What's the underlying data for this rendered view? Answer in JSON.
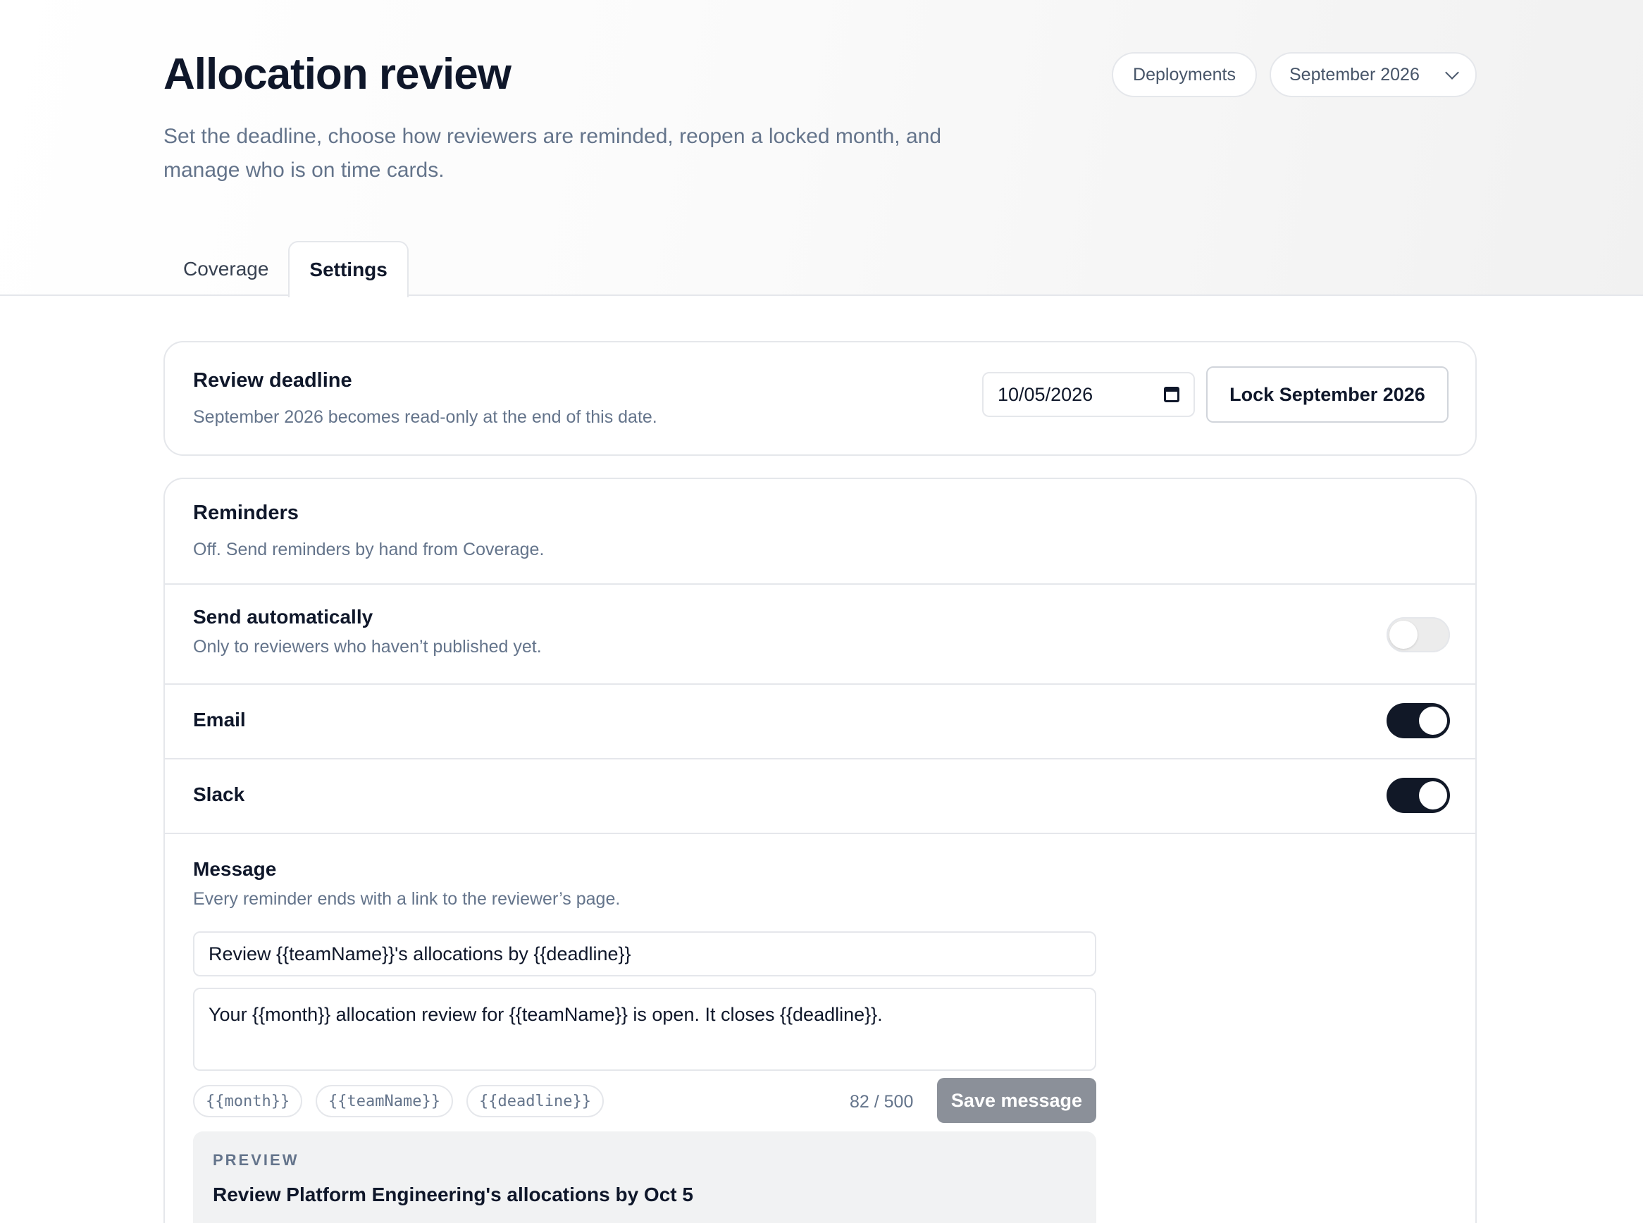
{
  "header": {
    "title": "Allocation review",
    "subtitle": "Set the deadline, choose how reviewers are reminded, reopen a locked month, and manage who is on time cards.",
    "deployments_label": "Deployments",
    "month_selector": "September 2026"
  },
  "tabs": [
    {
      "label": "Coverage",
      "active": false
    },
    {
      "label": "Settings",
      "active": true
    }
  ],
  "deadline": {
    "title": "Review deadline",
    "description": "September 2026 becomes read-only at the end of this date.",
    "date_value": "10/05/2026",
    "lock_button": "Lock September 2026"
  },
  "reminders": {
    "title": "Reminders",
    "status": "Off. Send reminders by hand from Coverage.",
    "send_auto": {
      "label": "Send automatically",
      "description": "Only to reviewers who haven’t published yet.",
      "enabled": false
    },
    "email": {
      "label": "Email",
      "enabled": true
    },
    "slack": {
      "label": "Slack",
      "enabled": true
    },
    "message": {
      "label": "Message",
      "description": "Every reminder ends with a link to the reviewer’s page.",
      "subject": "Review {{teamName}}'s allocations by {{deadline}}",
      "body": "Your {{month}} allocation review for {{teamName}} is open. It closes {{deadline}}.",
      "variables": [
        "{{month}}",
        "{{teamName}}",
        "{{deadline}}"
      ],
      "counter": "82 / 500",
      "save_button": "Save message"
    },
    "preview": {
      "label": "PREVIEW",
      "subject": "Review Platform Engineering's allocations by Oct 5"
    }
  },
  "colors": {
    "toggle_on": "#111827",
    "toggle_off": "#ececec",
    "save_disabled": "#8b9099"
  }
}
